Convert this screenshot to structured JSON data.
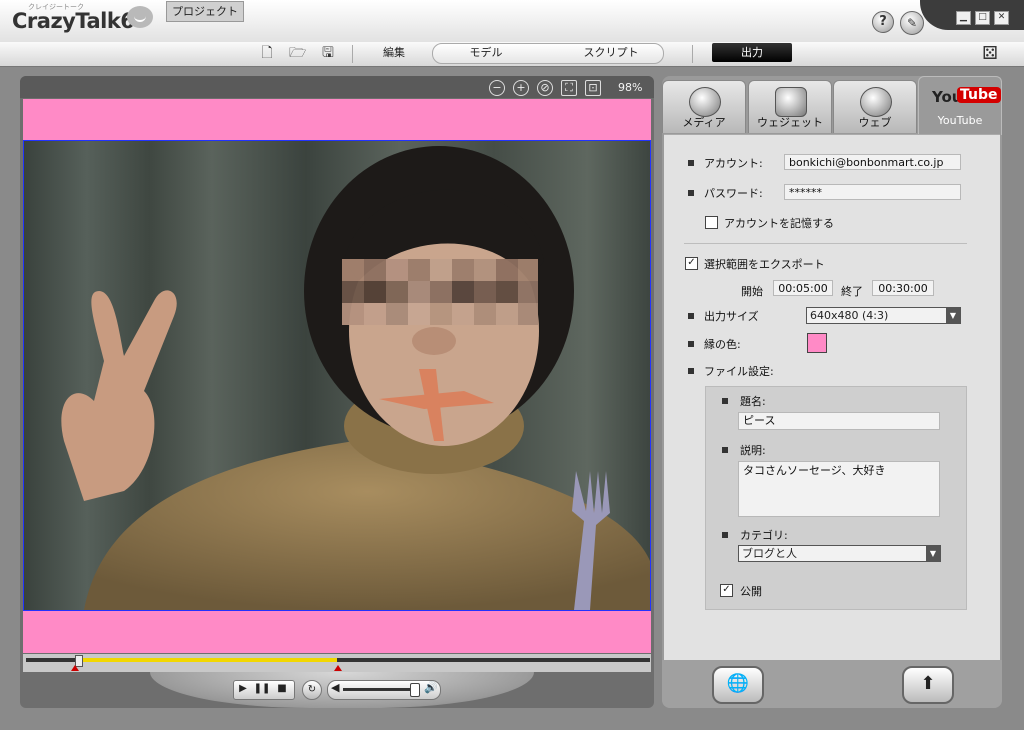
{
  "app": {
    "name": "CrazyTalk6",
    "subtitle": "クレイジートーク"
  },
  "window_controls": {
    "minimize": "▁",
    "maximize": "□",
    "close": "✕"
  },
  "toolbar": {
    "project": "プロジェクト",
    "edit": "編集",
    "model": "モデル",
    "script": "スクリプト",
    "output": "出力"
  },
  "stage": {
    "zoom": "98%",
    "background_color": "#ff8ac6",
    "timeline": {
      "in_fraction": 0.09,
      "out_fraction": 0.5,
      "playhead_fraction": 0.09
    },
    "volume_fraction": 0.88
  },
  "tabs": [
    {
      "label": "メディア",
      "icon": "film-reel-icon"
    },
    {
      "label": "ウェジェット",
      "icon": "widget-icon"
    },
    {
      "label": "ウェブ",
      "icon": "www-globe-icon"
    },
    {
      "label": "YouTube",
      "icon": "youtube-logo",
      "active": true
    }
  ],
  "youtube_logo": {
    "you": "You",
    "tube": "Tube"
  },
  "form": {
    "account_label": "アカウント:",
    "account_value": "bonkichi@bonbonmart.co.jp",
    "password_label": "パスワード:",
    "password_value": "******",
    "remember_label": "アカウントを記憶する",
    "remember_checked": false,
    "export_range_label": "選択範囲をエクスポート",
    "export_range_checked": true,
    "start_label": "開始",
    "start_value": "00:05:00",
    "end_label": "終了",
    "end_value": "00:30:00",
    "output_size_label": "出力サイズ",
    "output_size_value": "640x480 (4:3)",
    "border_color_label": "縁の色:",
    "border_color": "#ff8ac6",
    "file_settings_label": "ファイル設定:",
    "title_label": "題名:",
    "title_value": "ピース",
    "description_label": "説明:",
    "description_value": "タコさんソーセージ、大好き",
    "category_label": "カテゴリ:",
    "category_value": "ブログと人",
    "public_label": "公開",
    "public_checked": true
  }
}
